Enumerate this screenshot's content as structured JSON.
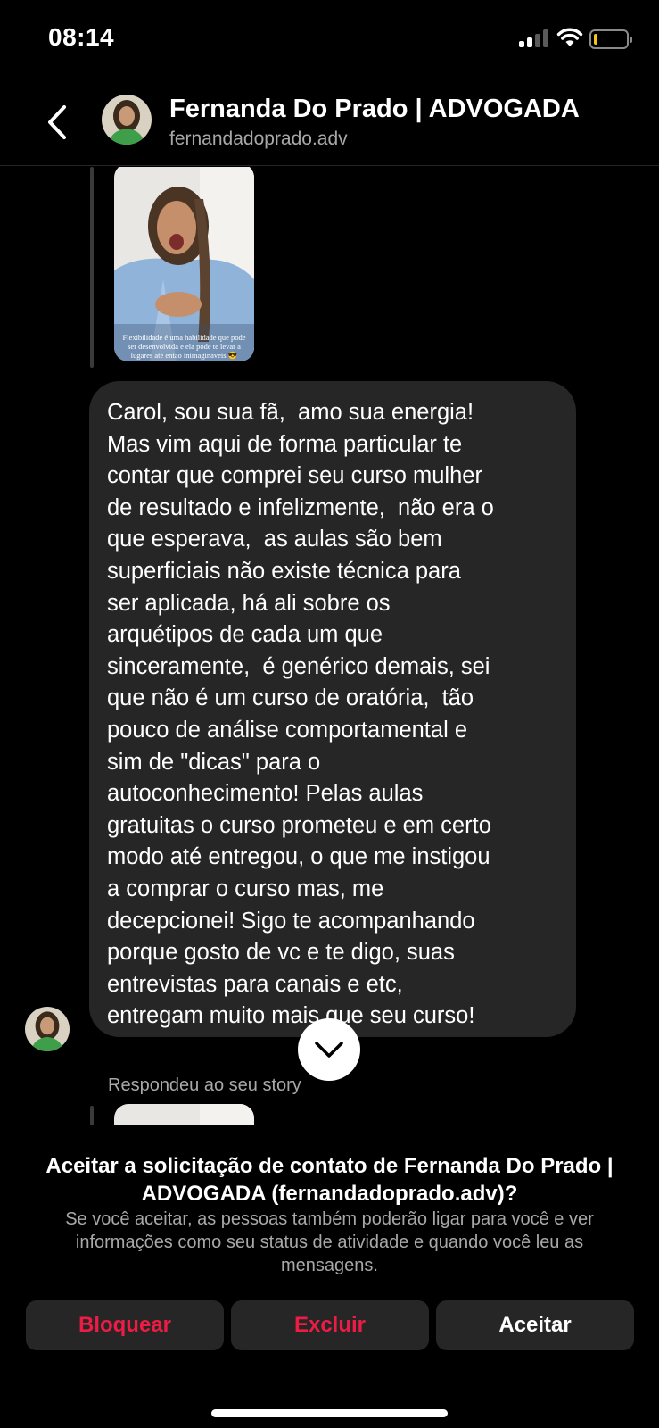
{
  "status_bar": {
    "time": "08:14",
    "signal_icon": "cellular-signal-icon",
    "wifi_icon": "wifi-icon",
    "battery_icon": "battery-low-icon",
    "battery_level": 0.12,
    "battery_color": "#f5c518"
  },
  "header": {
    "back_icon": "chevron-left-icon",
    "name": "Fernanda Do Prado | ADVOGADA",
    "username": "fernandadoprado.adv"
  },
  "story_top": {
    "caption": "Flexibilidade é uma habilidade que pode ser desenvolvida e ela pode te levar a lugares até então inimagináveis 😎"
  },
  "message": {
    "text": "Carol, sou sua fã,  amo sua energia!\nMas vim aqui de forma particular te\ncontar que comprei seu curso mulher\nde resultado e infelizmente,  não era o\nque esperava,  as aulas são bem\nsuperficiais não existe técnica para\nser aplicada, há ali sobre os\narquétipos de cada um que\nsinceramente,  é genérico demais, sei\nque não é um curso de oratória,  tão\npouco de análise comportamental e\nsim de \"dicas\" para o\nautoconhecimento! Pelas aulas\ngratuitas o curso prometeu e em certo\nmodo até entregou, o que me instigou\na comprar o curso mas, me\ndecepcionei! Sigo te acompanhando\nporque gosto de vc e te digo, suas\nentrevistas para canais e etc,\nentregam muito mais que seu curso!"
  },
  "scroll_down_icon": "chevron-down-icon",
  "reply_label": "Respondeu ao seu story",
  "request": {
    "title": "Aceitar a solicitação de contato de Fernanda Do Prado | ADVOGADA (fernandadoprado.adv)?",
    "description": "Se você aceitar, as pessoas também poderão ligar para você e ver informações como seu status de atividade e quando você leu as mensagens.",
    "buttons": {
      "block": "Bloquear",
      "delete": "Excluir",
      "accept": "Aceitar"
    }
  },
  "colors": {
    "background": "#000000",
    "bubble": "#262626",
    "danger": "#ed1c45",
    "secondary_text": "#a8a8a8"
  }
}
